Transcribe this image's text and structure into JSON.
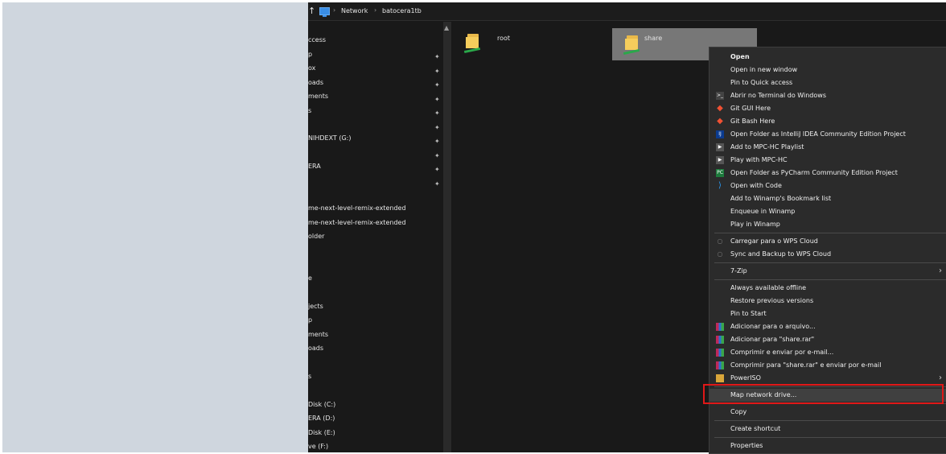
{
  "address_bar": {
    "up_glyph": "↑",
    "separator": "›",
    "crumbs": [
      "Network",
      "batocera1tb"
    ]
  },
  "nav": {
    "items": [
      "ccess",
      "p",
      "ox",
      "oads",
      "ments",
      "s",
      "",
      "NIHDEXT (G:)",
      "",
      "ERA",
      "",
      "",
      "me-next-level-remix-extended",
      "me-next-level-remix-extended",
      "older",
      "",
      "e",
      "",
      "jects",
      "p",
      "ments",
      "oads",
      "",
      "s",
      "",
      "Disk (C:)",
      "ERA (D:)",
      "Disk (E:)",
      "ve (F:)"
    ],
    "pin_glyph": "✦"
  },
  "folders": [
    {
      "name": "root",
      "selected": false
    },
    {
      "name": "share",
      "selected": true
    }
  ],
  "context_menu": {
    "items": [
      {
        "label": "Open",
        "icon": "",
        "bold": true
      },
      {
        "label": "Open in new window",
        "icon": ""
      },
      {
        "label": "Pin to Quick access",
        "icon": ""
      },
      {
        "label": "Abrir no Terminal do Windows",
        "icon": "terminal-icon"
      },
      {
        "label": "Git GUI Here",
        "icon": "git-icon"
      },
      {
        "label": "Git Bash Here",
        "icon": "git-icon"
      },
      {
        "label": "Open Folder as IntelliJ IDEA Community Edition Project",
        "icon": "intellij-icon"
      },
      {
        "label": "Add to MPC-HC Playlist",
        "icon": "mpc-icon"
      },
      {
        "label": "Play with MPC-HC",
        "icon": "mpc-icon"
      },
      {
        "label": "Open Folder as PyCharm Community Edition Project",
        "icon": "pycharm-icon"
      },
      {
        "label": "Open with Code",
        "icon": "vscode-icon"
      },
      {
        "label": "Add to Winamp's Bookmark list",
        "icon": ""
      },
      {
        "label": "Enqueue in Winamp",
        "icon": ""
      },
      {
        "label": "Play in Winamp",
        "icon": ""
      },
      {
        "label": "Carregar para o WPS Cloud",
        "icon": "wps-cloud-icon"
      },
      {
        "label": "Sync and Backup to WPS Cloud",
        "icon": "wps-cloud-icon"
      },
      {
        "label": "7-Zip",
        "icon": "",
        "submenu": true
      },
      {
        "label": "Always available offline",
        "icon": ""
      },
      {
        "label": "Restore previous versions",
        "icon": ""
      },
      {
        "label": "Pin to Start",
        "icon": ""
      },
      {
        "label": "Adicionar para o arquivo...",
        "icon": "winrar-icon"
      },
      {
        "label": "Adicionar para \"share.rar\"",
        "icon": "winrar-icon"
      },
      {
        "label": "Comprimir e enviar por e-mail...",
        "icon": "winrar-icon"
      },
      {
        "label": "Comprimir para \"share.rar\" e enviar por e-mail",
        "icon": "winrar-icon"
      },
      {
        "label": "PowerISO",
        "icon": "poweriso-icon",
        "submenu": true
      },
      {
        "label": "Map network drive...",
        "icon": "",
        "highlighted": true
      },
      {
        "label": "Copy",
        "icon": ""
      },
      {
        "label": "Create shortcut",
        "icon": ""
      },
      {
        "label": "Properties",
        "icon": ""
      }
    ],
    "submenu_glyph": "›"
  },
  "colors": {
    "explorer_bg": "#191919",
    "menu_bg": "#2b2b2b",
    "highlight_box": "#e01818",
    "selected_tile": "#777777"
  }
}
